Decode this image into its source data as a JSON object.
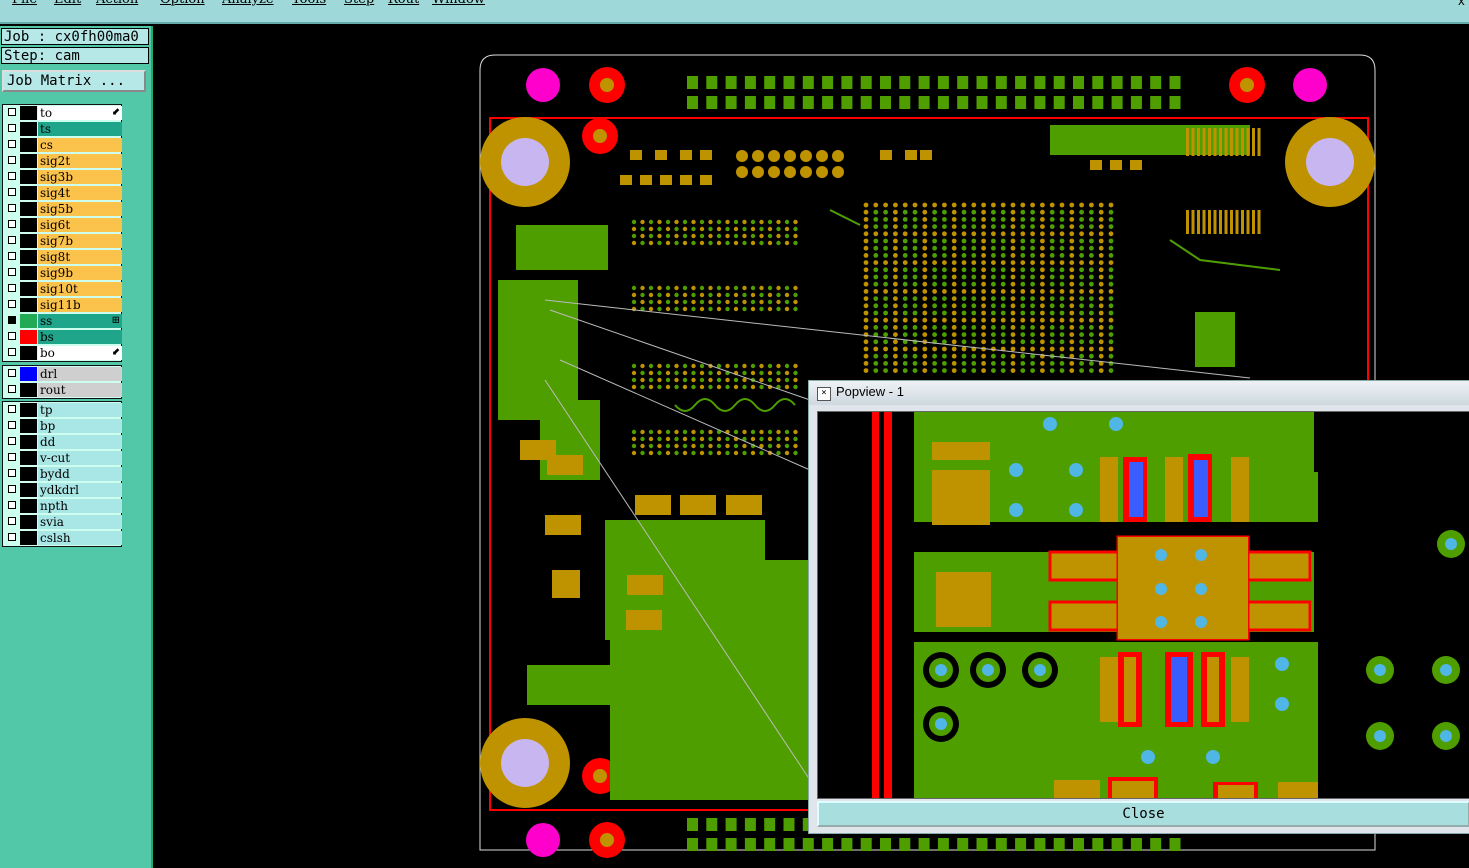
{
  "menu": [
    "File",
    "Edit",
    "Action",
    "Option",
    "Analyze",
    "Tools",
    "Step",
    "Rout",
    "Window"
  ],
  "window_close": "x",
  "job": {
    "job_label": "Job : cx0fh00ma0",
    "step_label": "Step: cam",
    "job_matrix_button": "Job Matrix ..."
  },
  "layers_board": [
    {
      "name": "to",
      "style": "white",
      "swatch": "#000000",
      "arrow": "⬋"
    },
    {
      "name": "ts",
      "style": "teal",
      "swatch": "#000000"
    },
    {
      "name": "cs",
      "style": "orange",
      "swatch": "#000000"
    },
    {
      "name": "sig2t",
      "style": "orange",
      "swatch": "#000000"
    },
    {
      "name": "sig3b",
      "style": "orange",
      "swatch": "#000000"
    },
    {
      "name": "sig4t",
      "style": "orange",
      "swatch": "#000000"
    },
    {
      "name": "sig5b",
      "style": "orange",
      "swatch": "#000000"
    },
    {
      "name": "sig6t",
      "style": "orange",
      "swatch": "#000000"
    },
    {
      "name": "sig7b",
      "style": "orange",
      "swatch": "#000000"
    },
    {
      "name": "sig8t",
      "style": "orange",
      "swatch": "#000000"
    },
    {
      "name": "sig9b",
      "style": "orange",
      "swatch": "#000000"
    },
    {
      "name": "sig10t",
      "style": "orange",
      "swatch": "#000000"
    },
    {
      "name": "sig11b",
      "style": "orange",
      "swatch": "#000000"
    },
    {
      "name": "ss",
      "style": "teal",
      "swatch": "#22aa55",
      "arrow": "⊞",
      "checked": true
    },
    {
      "name": "bs",
      "style": "teal",
      "swatch": "#ff0000"
    },
    {
      "name": "bo",
      "style": "white",
      "swatch": "#000000",
      "arrow": "⬋"
    }
  ],
  "layers_drill": [
    {
      "name": "drl",
      "style": "grey",
      "swatch": "#0000ff"
    },
    {
      "name": "rout",
      "style": "grey",
      "swatch": "#000000"
    }
  ],
  "layers_misc": [
    {
      "name": "tp",
      "style": "cyan",
      "swatch": "#000000"
    },
    {
      "name": "bp",
      "style": "cyan",
      "swatch": "#000000"
    },
    {
      "name": "dd",
      "style": "cyan",
      "swatch": "#000000"
    },
    {
      "name": "v-cut",
      "style": "cyan",
      "swatch": "#000000"
    },
    {
      "name": "bydd",
      "style": "cyan",
      "swatch": "#000000"
    },
    {
      "name": "ydkdrl",
      "style": "cyan",
      "swatch": "#000000"
    },
    {
      "name": "npth",
      "style": "cyan",
      "swatch": "#000000"
    },
    {
      "name": "svia",
      "style": "cyan",
      "swatch": "#000000"
    },
    {
      "name": "cslsh",
      "style": "cyan",
      "swatch": "#000000"
    }
  ],
  "popview": {
    "title": "Popview - 1",
    "close_label": "Close"
  },
  "colors": {
    "copper": "#4f9e00",
    "pad": "#bf9300",
    "outline": "#ff0000",
    "via": "#4fb6e6",
    "mount": "#c8b6f0",
    "magenta": "#ff00cc"
  }
}
